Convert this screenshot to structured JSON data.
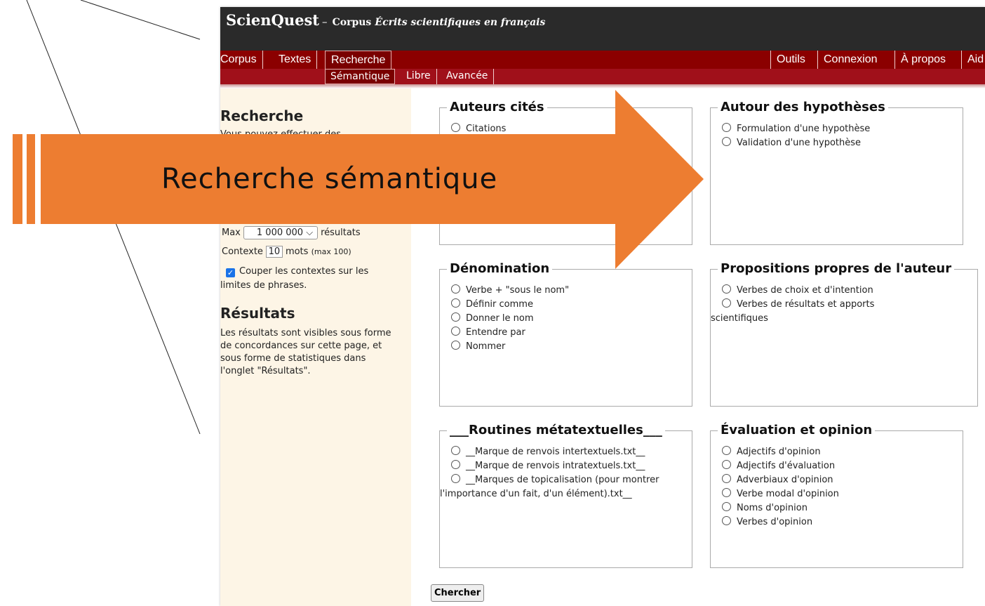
{
  "site": {
    "name": "ScienQuest",
    "separator": "–",
    "corpus_label": "Corpus",
    "corpus_title": "Écrits scientifiques en français"
  },
  "nav": {
    "corpus": "Corpus",
    "textes": "Textes",
    "recherche": "Recherche",
    "outils": "Outils",
    "connexion": "Connexion",
    "apropos": "À propos",
    "aide": "Aid"
  },
  "subnav": {
    "semantique": "Sémantique",
    "libre": "Libre",
    "avancee": "Avancée"
  },
  "sidebar": {
    "search_heading": "Recherche",
    "search_intro": "Vous pouvez effectuer des",
    "max_label": "Max",
    "max_value": "1 000 000",
    "results_label": "résultats",
    "context_label": "Contexte",
    "context_value": "10",
    "context_unit": "mots",
    "context_max": "(max 100)",
    "cut_label_1": "Couper les contextes sur les",
    "cut_label_2": "limites de phrases.",
    "results_heading": "Résultats",
    "results_text": "Les résultats sont visibles sous forme de concordances sur cette page, et sous forme de statistiques dans l'onglet \"Résultats\"."
  },
  "panels": {
    "auteurs": {
      "title": "Auteurs cités",
      "options": [
        "Citations"
      ]
    },
    "hypotheses": {
      "title": "Autour des hypothèses",
      "options": [
        "Formulation d'une hypothèse",
        "Validation d'une hypothèse"
      ]
    },
    "denomination": {
      "title": "Dénomination",
      "options": [
        "Verbe + \"sous le nom\"",
        "Définir comme",
        "Donner le nom",
        "Entendre par",
        "Nommer"
      ]
    },
    "propositions": {
      "title": "Propositions propres de l'auteur",
      "options": [
        "Verbes de choix et d'intention",
        "Verbes de résultats et apports scientifiques"
      ]
    },
    "routines": {
      "title": "___Routines métatextuelles___",
      "options": [
        "__Marque de renvois intertextuels.txt__",
        "__Marque de renvois intratextuels.txt__",
        "__Marques de topicalisation (pour montrer l'importance d'un fait, d'un élément).txt__"
      ]
    },
    "evaluation": {
      "title": "Évaluation et opinion",
      "options": [
        "Adjectifs d'opinion",
        "Adjectifs d'évaluation",
        "Adverbiaux d'opinion",
        "Verbe modal d'opinion",
        "Noms d'opinion",
        "Verbes d'opinion"
      ]
    }
  },
  "search_button": "Chercher",
  "banner": {
    "text": "Recherche sémantique",
    "color": "#ed7d31"
  }
}
